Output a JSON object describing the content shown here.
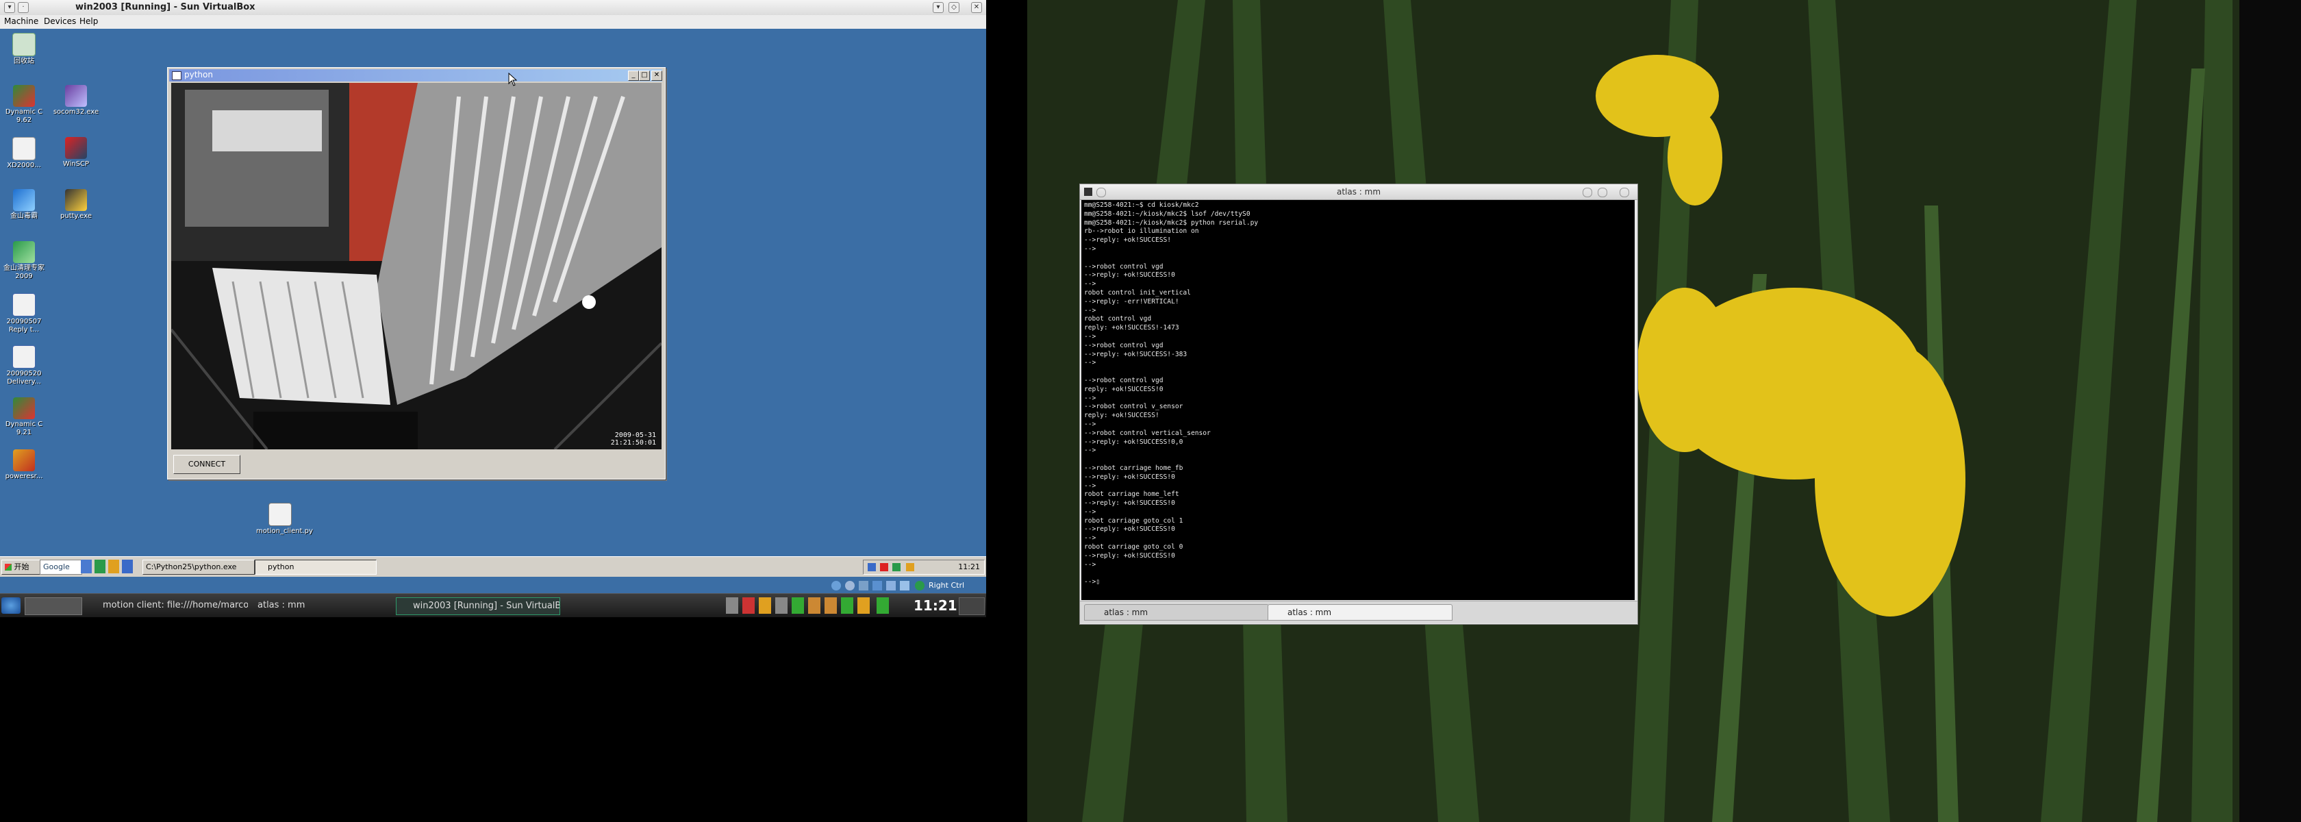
{
  "vbox": {
    "window_title": "win2003 [Running] - Sun VirtualBox",
    "menu": [
      "Machine",
      "Devices",
      "Help"
    ]
  },
  "desktop_icons": [
    {
      "label": "回收站"
    },
    {
      "label": "Dynamic C 9.62"
    },
    {
      "label": "socom32.exe"
    },
    {
      "label": "XD2000..."
    },
    {
      "label": "WinSCP"
    },
    {
      "label": "金山毒霸"
    },
    {
      "label": "putty.exe"
    },
    {
      "label": "金山清理专家2009"
    },
    {
      "label": "20090507 Reply t..."
    },
    {
      "label": "20090520 Delivery..."
    },
    {
      "label": "Dynamic C 9.21"
    },
    {
      "label": "poweresr..."
    },
    {
      "label": "motion_client.py"
    }
  ],
  "python_window": {
    "title": "python",
    "timestamp_line1": "2009-05-31",
    "timestamp_line2": "21:21:50:01",
    "connect_label": "CONNECT"
  },
  "guest_taskbar": {
    "start": "开始",
    "google": "Google",
    "task1": "C:\\Python25\\python.exe",
    "task2": "python",
    "clock": "11:21",
    "keyboard": "Right Ctrl"
  },
  "kde_panel": {
    "task1": "motion client: file:///home/marco/...",
    "task2": "atlas : mm",
    "task3": "win2003 [Running] - Sun VirtualBox",
    "clock": "11:21"
  },
  "terminal": {
    "title": "atlas : mm",
    "lines": [
      "mm@S258-4021:~$ cd kiosk/mkc2",
      "mm@S258-4021:~/kiosk/mkc2$ lsof /dev/ttyS0",
      "mm@S258-4021:~/kiosk/mkc2$ python rserial.py",
      "rb-->robot io illumination on",
      "-->reply: +ok!SUCCESS!",
      "-->",
      "",
      "-->robot control vgd",
      "-->reply: +ok!SUCCESS!0",
      "-->",
      "robot control init_vertical",
      "-->reply: -err!VERTICAL!",
      "-->",
      "robot control vgd",
      "reply: +ok!SUCCESS!-1473",
      "-->",
      "-->robot control vgd",
      "-->reply: +ok!SUCCESS!-383",
      "-->",
      "",
      "-->robot control vgd",
      "reply: +ok!SUCCESS!0",
      "-->",
      "-->robot control v_sensor",
      "reply: +ok!SUCCESS!",
      "-->",
      "-->robot control vertical_sensor",
      "-->reply: +ok!SUCCESS!0,0",
      "-->",
      "",
      "-->robot carriage home_fb",
      "-->reply: +ok!SUCCESS!0",
      "-->",
      "robot carriage home_left",
      "-->reply: +ok!SUCCESS!0",
      "-->",
      "robot carriage goto_col 1",
      "-->reply: +ok!SUCCESS!0",
      "-->",
      "robot carriage goto_col 0",
      "-->reply: +ok!SUCCESS!0",
      "-->",
      "",
      "-->▯"
    ],
    "tab1": "atlas : mm",
    "tab2": "atlas : mm"
  }
}
